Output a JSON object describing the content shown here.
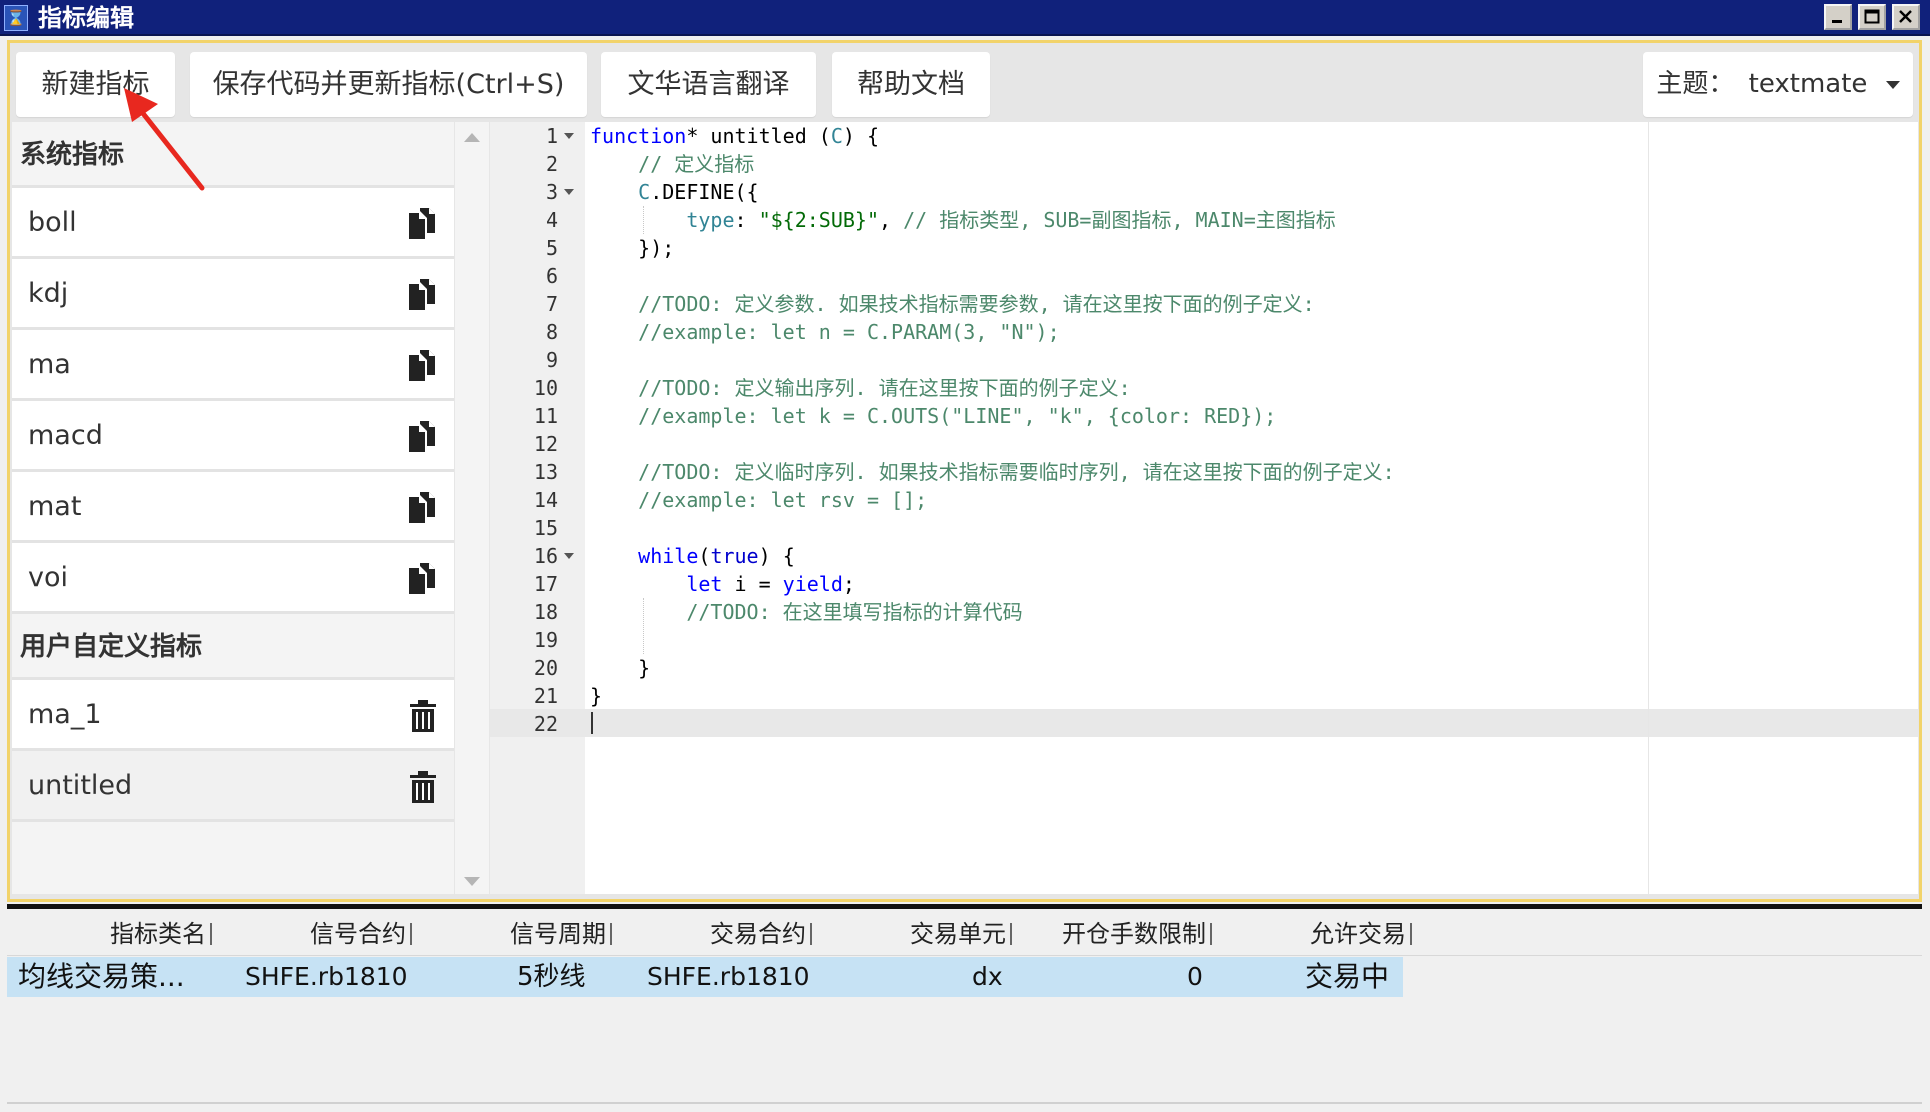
{
  "window": {
    "title": "指标编辑",
    "icon": "hourglass-icon"
  },
  "toolbar": {
    "new_label": "新建指标",
    "save_label": "保存代码并更新指标(Ctrl+S)",
    "translate_label": "文华语言翻译",
    "help_label": "帮助文档",
    "theme_prefix": "主题：",
    "theme_value": "textmate"
  },
  "sidebar": {
    "system_header": "系统指标",
    "system_items": [
      {
        "label": "boll",
        "icon": "copy-icon"
      },
      {
        "label": "kdj",
        "icon": "copy-icon"
      },
      {
        "label": "ma",
        "icon": "copy-icon"
      },
      {
        "label": "macd",
        "icon": "copy-icon"
      },
      {
        "label": "mat",
        "icon": "copy-icon"
      },
      {
        "label": "voi",
        "icon": "copy-icon"
      }
    ],
    "user_header": "用户自定义指标",
    "user_items": [
      {
        "label": "ma_1",
        "icon": "trash-icon"
      },
      {
        "label": "untitled",
        "icon": "trash-icon"
      }
    ]
  },
  "editor": {
    "line_numbers": [
      "1",
      "2",
      "3",
      "4",
      "5",
      "6",
      "7",
      "8",
      "9",
      "10",
      "11",
      "12",
      "13",
      "14",
      "15",
      "16",
      "17",
      "18",
      "19",
      "20",
      "21",
      "22"
    ],
    "active_line": 22,
    "lines": [
      "function* untitled (C) {",
      "    // 定义指标",
      "    C.DEFINE({",
      "        type: \"${2:SUB}\", // 指标类型, SUB=副图指标, MAIN=主图指标",
      "    });",
      "",
      "    //TODO: 定义参数. 如果技术指标需要参数, 请在这里按下面的例子定义:",
      "    //example: let n = C.PARAM(3, \"N\");",
      "",
      "    //TODO: 定义输出序列. 请在这里按下面的例子定义:",
      "    //example: let k = C.OUTS(\"LINE\", \"k\", {color: RED});",
      "",
      "    //TODO: 定义临时序列. 如果技术指标需要临时序列, 请在这里按下面的例子定义:",
      "    //example: let rsv = [];",
      "",
      "    while(true) {",
      "        let i = yield;",
      "        //TODO: 在这里填写指标的计算代码",
      "",
      "    }",
      "}",
      ""
    ]
  },
  "table": {
    "headers": [
      "指标类名",
      "信号合约",
      "信号周期",
      "交易合约",
      "交易单元",
      "开仓手数限制",
      "允许交易"
    ],
    "rows": [
      [
        "均线交易策...",
        "SHFE.rb1810",
        "5秒线",
        "SHFE.rb1810",
        "dx",
        "0",
        "交易中"
      ]
    ]
  },
  "colors": {
    "titlebar": "#10217b",
    "frame_border": "#f2d36a",
    "selected_row": "#c6e2f4",
    "keyword": "#0000ff",
    "comment": "#4c886b",
    "string": "#036a07"
  },
  "annotation": {
    "arrow_color": "#e8281f",
    "points_to": "新建指标"
  }
}
